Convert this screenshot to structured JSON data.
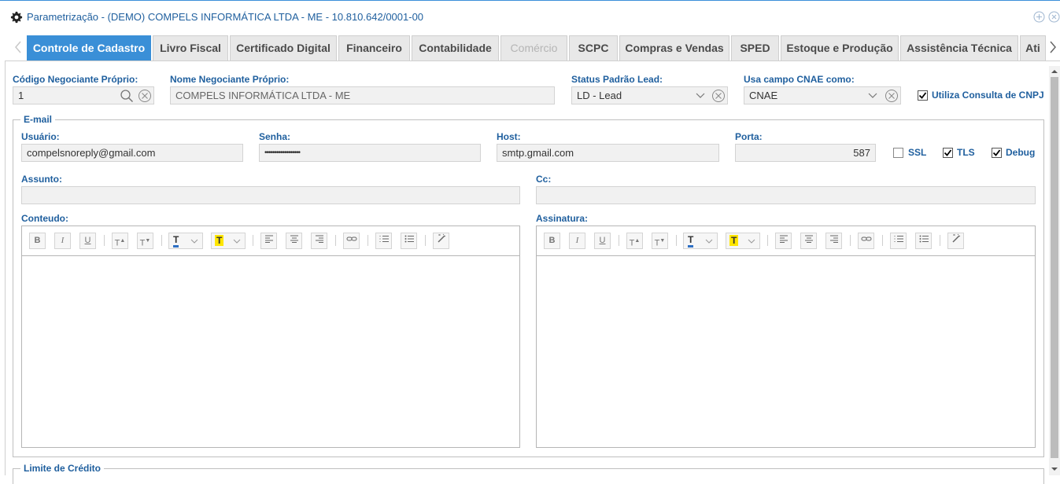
{
  "window": {
    "title": "Parametrização - (DEMO) COMPELS INFORMÁTICA LTDA - ME - 10.810.642/0001-00"
  },
  "tabs": [
    {
      "label": "Controle de Cadastro",
      "active": true
    },
    {
      "label": "Livro Fiscal"
    },
    {
      "label": "Certificado Digital"
    },
    {
      "label": "Financeiro"
    },
    {
      "label": "Contabilidade"
    },
    {
      "label": "Comércio",
      "disabled": true
    },
    {
      "label": "SCPC"
    },
    {
      "label": "Compras e Vendas"
    },
    {
      "label": "SPED"
    },
    {
      "label": "Estoque e Produção"
    },
    {
      "label": "Assistência Técnica"
    },
    {
      "label": "Ati"
    }
  ],
  "cadastro": {
    "codigo_label": "Código Negociante Próprio:",
    "codigo_value": "1",
    "nome_label": "Nome Negociante Próprio:",
    "nome_value": "COMPELS INFORMÁTICA LTDA - ME",
    "status_label": "Status Padrão Lead:",
    "status_value": "LD - Lead",
    "cnae_label": "Usa campo CNAE como:",
    "cnae_value": "CNAE",
    "consulta_cnpj_label": "Utiliza Consulta de CNPJ",
    "consulta_cnpj_checked": true
  },
  "email": {
    "legend": "E-mail",
    "usuario_label": "Usuário:",
    "usuario_value": "compelsnoreply@gmail.com",
    "senha_label": "Senha:",
    "senha_value": "••••••••••••••••••",
    "host_label": "Host:",
    "host_value": "smtp.gmail.com",
    "porta_label": "Porta:",
    "porta_value": "587",
    "ssl_label": "SSL",
    "ssl_checked": false,
    "tls_label": "TLS",
    "tls_checked": true,
    "debug_label": "Debug",
    "debug_checked": true,
    "assunto_label": "Assunto:",
    "assunto_value": "",
    "cc_label": "Cc:",
    "cc_value": "",
    "conteudo_label": "Conteudo:",
    "assinatura_label": "Assinatura:"
  },
  "toolbar_buttons": {
    "bold": "B",
    "italic": "I",
    "underline": "U",
    "superscript": "T",
    "subscript": "T",
    "font_color": "T",
    "highlight": "T"
  },
  "credit": {
    "legend": "Limite de Crédito"
  },
  "colors": {
    "accent": "#3a8fd7",
    "label": "#1f5f9e",
    "highlight_yellow": "#ffe600"
  }
}
